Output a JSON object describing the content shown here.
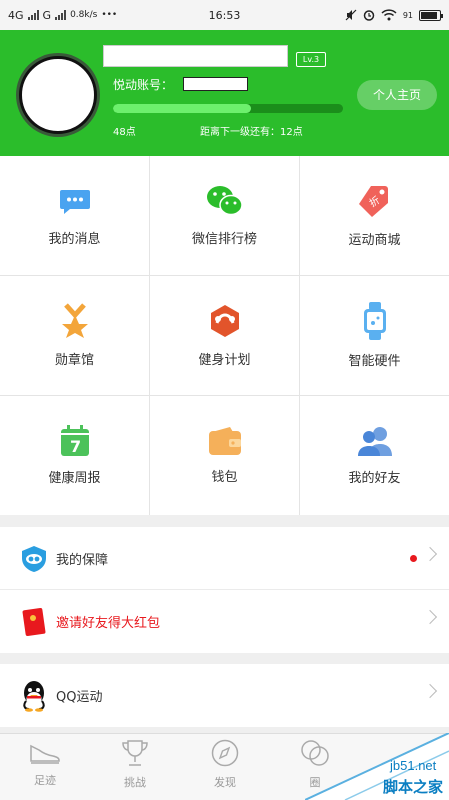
{
  "status_bar": {
    "network1": "4G",
    "network2": "G",
    "speed": "0.8k/s",
    "dots": "•••",
    "time": "16:53",
    "battery": "91",
    "battery_level": 0.91
  },
  "header": {
    "level_badge": "Lv.3",
    "account_label": "悦动账号：",
    "progress": 0.6,
    "points": "48点",
    "next_level": "距离下一级还有：12点",
    "homepage_button": "个人主页",
    "accent": "#2bbd2b"
  },
  "grid": {
    "items": [
      {
        "label": "我的消息",
        "icon": "message-icon"
      },
      {
        "label": "微信排行榜",
        "icon": "wechat-icon"
      },
      {
        "label": "运动商城",
        "icon": "shop-tag-icon"
      },
      {
        "label": "勋章馆",
        "icon": "medal-icon"
      },
      {
        "label": "健身计划",
        "icon": "fitness-plan-icon"
      },
      {
        "label": "智能硬件",
        "icon": "smart-watch-icon"
      },
      {
        "label": "健康周报",
        "icon": "calendar-icon"
      },
      {
        "label": "钱包",
        "icon": "wallet-icon"
      },
      {
        "label": "我的好友",
        "icon": "friends-icon"
      }
    ],
    "calendar_number": "7",
    "shop_tag_text": "折"
  },
  "list1": {
    "items": [
      {
        "label": "我的保障",
        "icon": "shield-icon"
      },
      {
        "label": "邀请好友得大红包",
        "icon": "red-envelope-icon",
        "color": "#e8191e"
      }
    ]
  },
  "list2": {
    "items": [
      {
        "label": "QQ运动",
        "icon": "qq-icon"
      }
    ]
  },
  "bottom_nav": {
    "tabs": [
      {
        "label": "足迹",
        "icon": "shoe-icon"
      },
      {
        "label": "挑战",
        "icon": "trophy-icon"
      },
      {
        "label": "发现",
        "icon": "compass-icon"
      },
      {
        "label": "圈",
        "icon": "circle-icon"
      }
    ]
  },
  "watermark": {
    "site": "jb51.net",
    "name": "脚本之家"
  }
}
